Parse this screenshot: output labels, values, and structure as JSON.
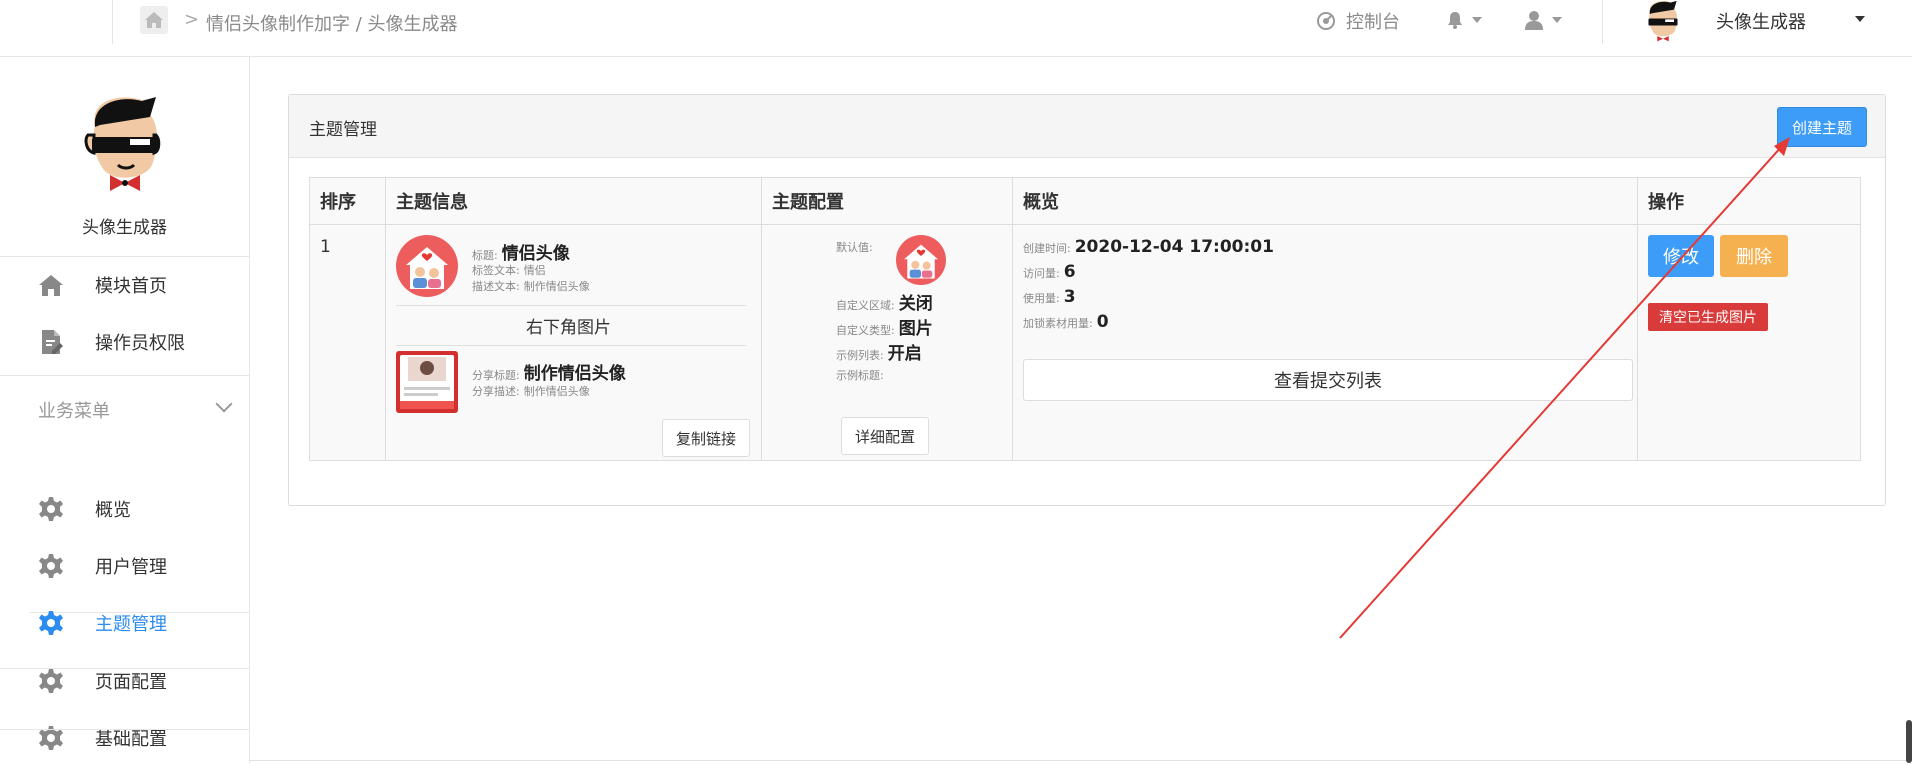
{
  "breadcrumb": {
    "sep": ">",
    "text": "情侣头像制作加字 / 头像生成器"
  },
  "topbar": {
    "console_label": "控制台",
    "app_title": "头像生成器"
  },
  "sidebar": {
    "app_title": "头像生成器",
    "items_top": [
      {
        "label": "模块首页",
        "icon": "home-icon"
      },
      {
        "label": "操作员权限",
        "icon": "document-edit-icon"
      }
    ],
    "group_label": "业务菜单",
    "items": [
      {
        "label": "概览",
        "icon": "gear-icon"
      },
      {
        "label": "用户管理",
        "icon": "gear-icon"
      },
      {
        "label": "主题管理",
        "icon": "gear-icon",
        "active": true
      },
      {
        "label": "页面配置",
        "icon": "gear-icon"
      },
      {
        "label": "基础配置",
        "icon": "gear-icon"
      }
    ]
  },
  "panel": {
    "title": "主题管理",
    "create_button": "创建主题",
    "columns": [
      "排序",
      "主题信息",
      "主题配置",
      "概览",
      "操作"
    ],
    "row": {
      "order": "1",
      "info": {
        "title_label": "标题:",
        "title_value": "情侣头像",
        "tag_label": "标签文本:",
        "tag_value": "情侣",
        "desc_label": "描述文本:",
        "desc_value": "制作情侣头像",
        "corner_image_label": "右下角图片",
        "share_title_label": "分享标题:",
        "share_title_value": "制作情侣头像",
        "share_desc_label": "分享描述:",
        "share_desc_value": "制作情侣头像",
        "copy_link_button": "复制链接"
      },
      "config": {
        "default_label": "默认值:",
        "custom_area_label": "自定义区域:",
        "custom_area_value": "关闭",
        "custom_type_label": "自定义类型:",
        "custom_type_value": "图片",
        "example_list_label": "示例列表:",
        "example_list_value": "开启",
        "example_title_label": "示例标题:",
        "detail_button": "详细配置"
      },
      "overview": {
        "created_label": "创建时间:",
        "created_value": "2020-12-04 17:00:01",
        "visits_label": "访问量:",
        "visits_value": "6",
        "uses_label": "使用量:",
        "uses_value": "3",
        "lock_label": "加锁素材用量:",
        "lock_value": "0",
        "submissions_button": "查看提交列表"
      },
      "actions": {
        "edit_button": "修改",
        "delete_button": "删除",
        "clear_button": "清空已生成图片"
      }
    }
  },
  "colors": {
    "primary": "#3c9cf7",
    "warning": "#f5b04f",
    "danger": "#d93a3a",
    "active_menu": "#2d8cf0",
    "annotation_arrow": "#e53935"
  }
}
